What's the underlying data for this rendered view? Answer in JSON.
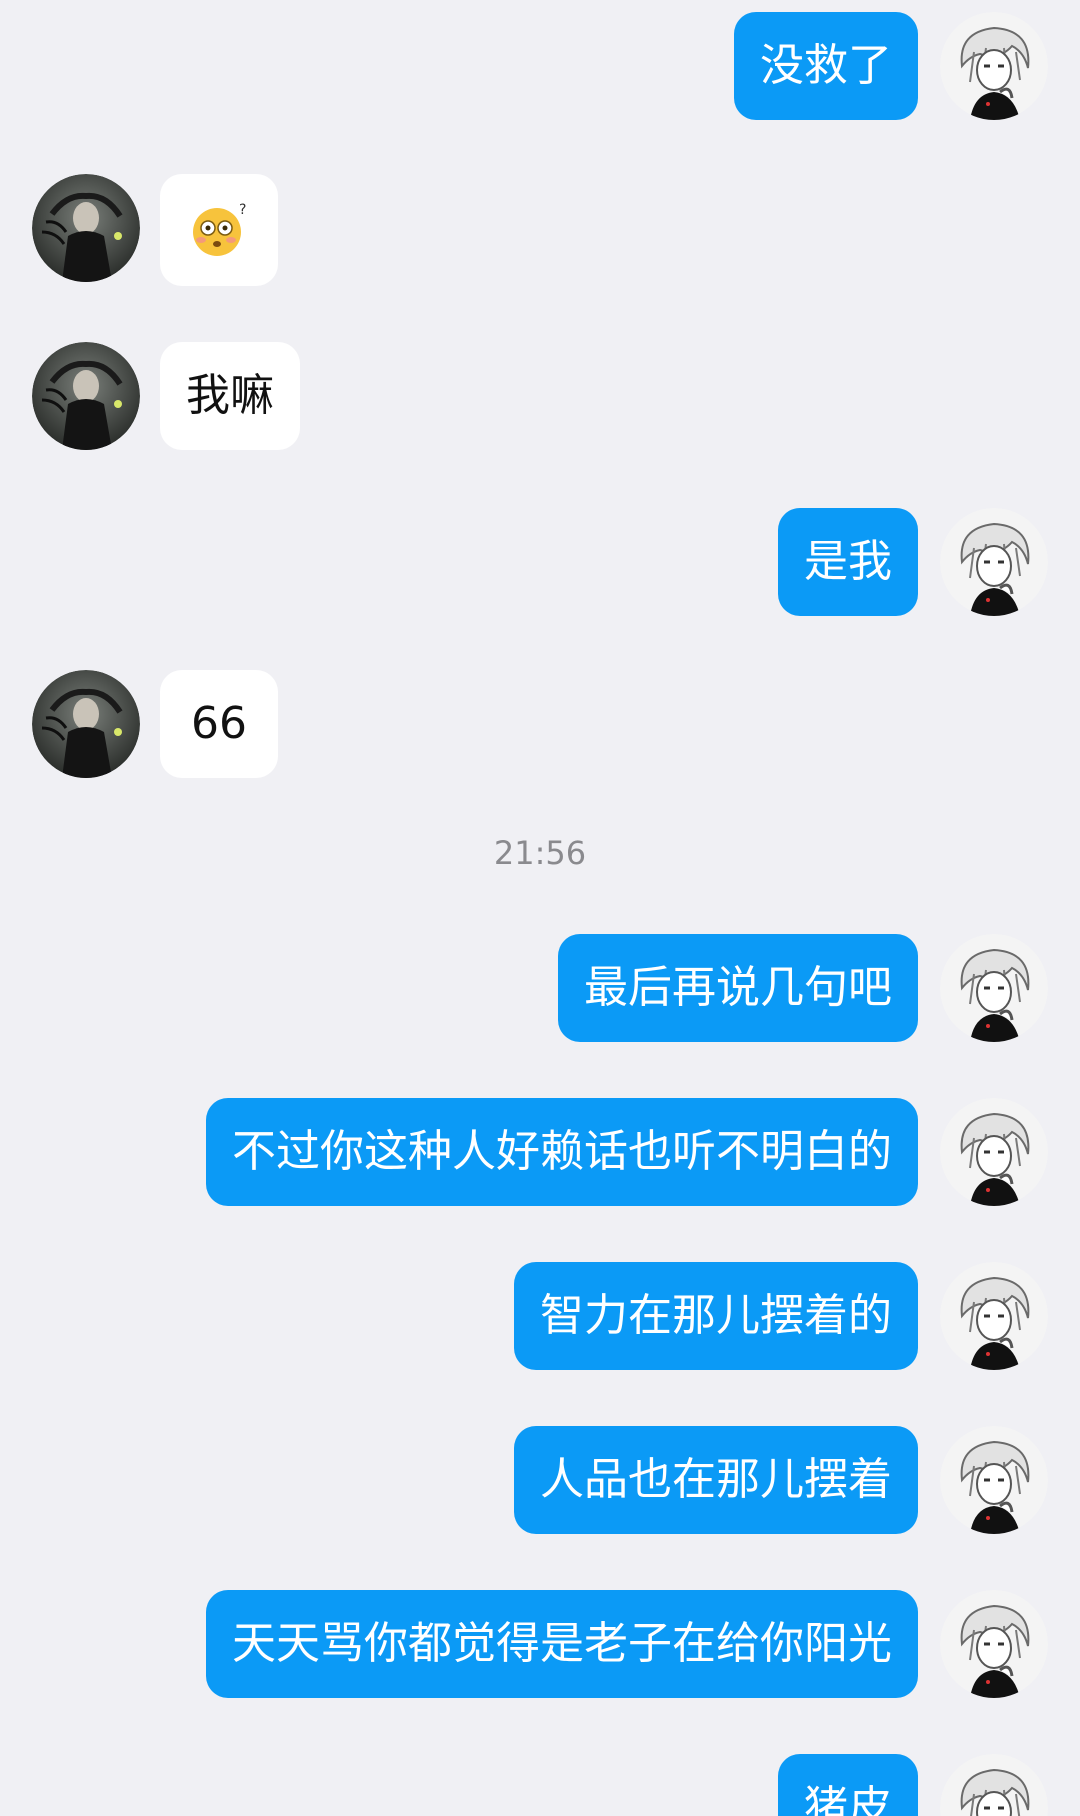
{
  "colors": {
    "background": "#f0f0f4",
    "outgoing_bubble": "#0b9af6",
    "incoming_bubble": "#ffffff",
    "timestamp_text": "#8a8a8e"
  },
  "messages": [
    {
      "sender": "me",
      "text": "没救了"
    },
    {
      "sender": "them",
      "type": "emoji",
      "emoji": "😳",
      "icon": "flushed-question-emoji-icon"
    },
    {
      "sender": "them",
      "text": "我嘛"
    },
    {
      "sender": "me",
      "text": "是我"
    },
    {
      "sender": "them",
      "text": "66"
    },
    {
      "type": "timestamp",
      "text": "21:56"
    },
    {
      "sender": "me",
      "text": "最后再说几句吧"
    },
    {
      "sender": "me",
      "text": "不过你这种人好赖话也听不明白的"
    },
    {
      "sender": "me",
      "text": "智力在那儿摆着的"
    },
    {
      "sender": "me",
      "text": "人品也在那儿摆着"
    },
    {
      "sender": "me",
      "text": "天天骂你都觉得是老子在给你阳光"
    },
    {
      "sender": "me",
      "text": "猪皮"
    }
  ]
}
